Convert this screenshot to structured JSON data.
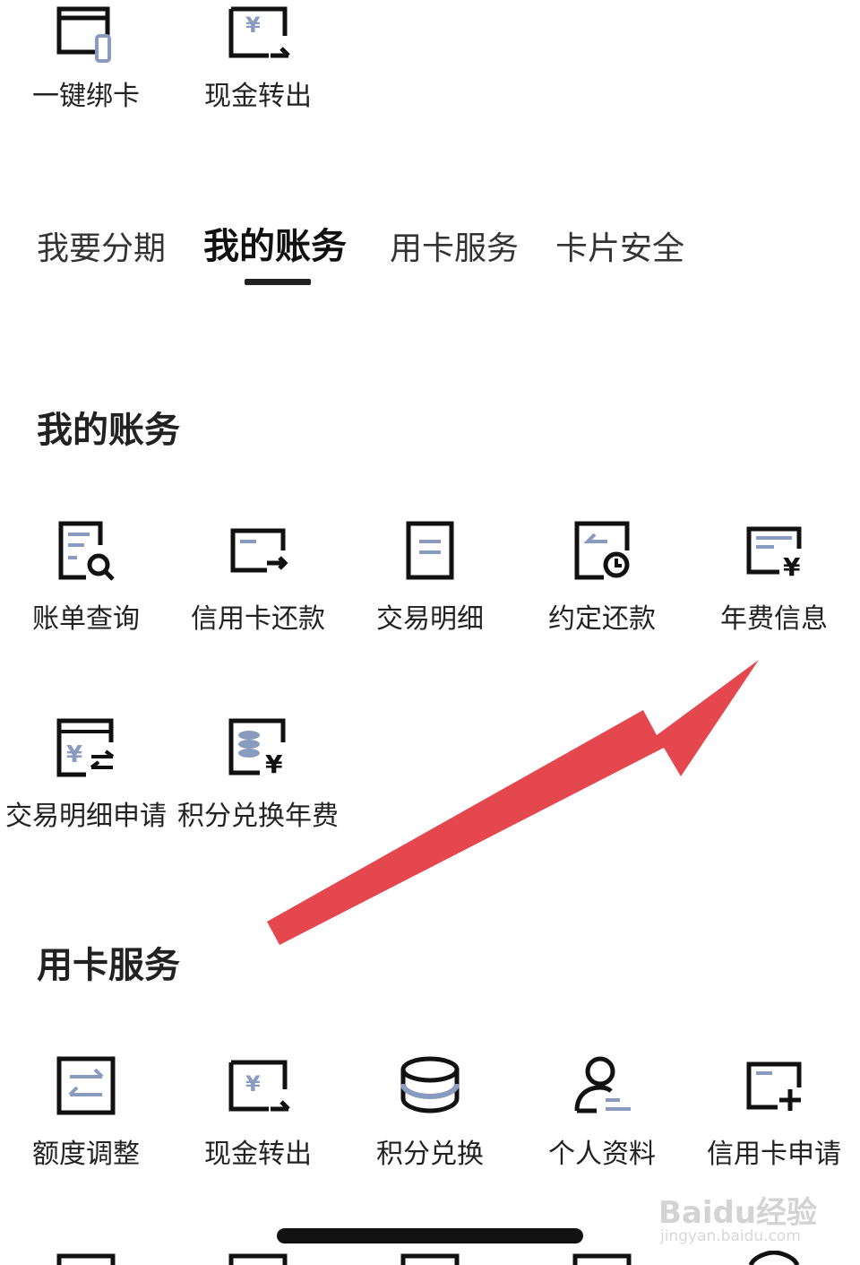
{
  "top_row": {
    "bind_card": "一键绑卡",
    "cash_out": "现金转出"
  },
  "tabs": [
    {
      "label": "我要分期",
      "active": false
    },
    {
      "label": "我的账务",
      "active": true
    },
    {
      "label": "用卡服务",
      "active": false
    },
    {
      "label": "卡片安全",
      "active": false
    }
  ],
  "my_account": {
    "title": "我的账务",
    "items": [
      {
        "label": "账单查询",
        "icon": "bill-query-icon"
      },
      {
        "label": "信用卡还款",
        "icon": "card-repay-icon"
      },
      {
        "label": "交易明细",
        "icon": "transaction-detail-icon"
      },
      {
        "label": "约定还款",
        "icon": "scheduled-repay-icon"
      },
      {
        "label": "年费信息",
        "icon": "annual-fee-icon"
      },
      {
        "label": "交易明细申请",
        "icon": "detail-apply-icon"
      },
      {
        "label": "积分兑换年费",
        "icon": "points-fee-icon"
      }
    ]
  },
  "card_service": {
    "title": "用卡服务",
    "items": [
      {
        "label": "额度调整",
        "icon": "limit-adjust-icon"
      },
      {
        "label": "现金转出",
        "icon": "cash-out-icon"
      },
      {
        "label": "积分兑换",
        "icon": "points-exchange-icon"
      },
      {
        "label": "个人资料",
        "icon": "profile-icon"
      },
      {
        "label": "信用卡申请",
        "icon": "card-apply-icon"
      }
    ]
  },
  "watermark": {
    "brand": "Baidu经验",
    "url": "jingyan.baidu.com"
  },
  "colors": {
    "accent_blue": "#8a9bc0",
    "arrow_red": "#e5474e",
    "icon_stroke": "#111111"
  }
}
